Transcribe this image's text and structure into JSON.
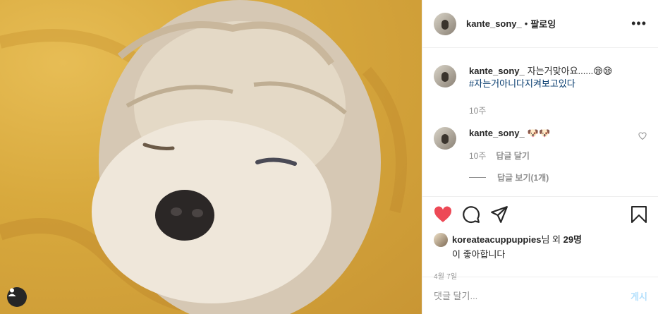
{
  "photo": {
    "alt_icon": "user-tag-icon"
  },
  "header": {
    "username": "kante_sony_",
    "dot": "•",
    "follow_label": "팔로잉",
    "more_label": "•••"
  },
  "comments": [
    {
      "username": "kante_sony_",
      "text": "자는거맞아요......😪😪",
      "hashtag": "#자는거아니다지켜보고있다",
      "time": "10주"
    },
    {
      "username": "kante_sony_",
      "text": "🐶🐶",
      "time": "10주",
      "reply_label": "답글 달기"
    }
  ],
  "view_replies_label": "답글 보기(1개)",
  "likes": {
    "liker": "koreateacuppuppies",
    "suffix": "님 외 ",
    "count": "29명",
    "line2": "이 좋아합니다"
  },
  "date": "4월 7일",
  "comment_input": {
    "placeholder": "댓글 달기...",
    "post_label": "게시"
  },
  "colors": {
    "like_red": "#ed4956",
    "post_blue": "#b2dffc",
    "hashtag": "#00376b",
    "photo_bg": "#d8a93d"
  }
}
